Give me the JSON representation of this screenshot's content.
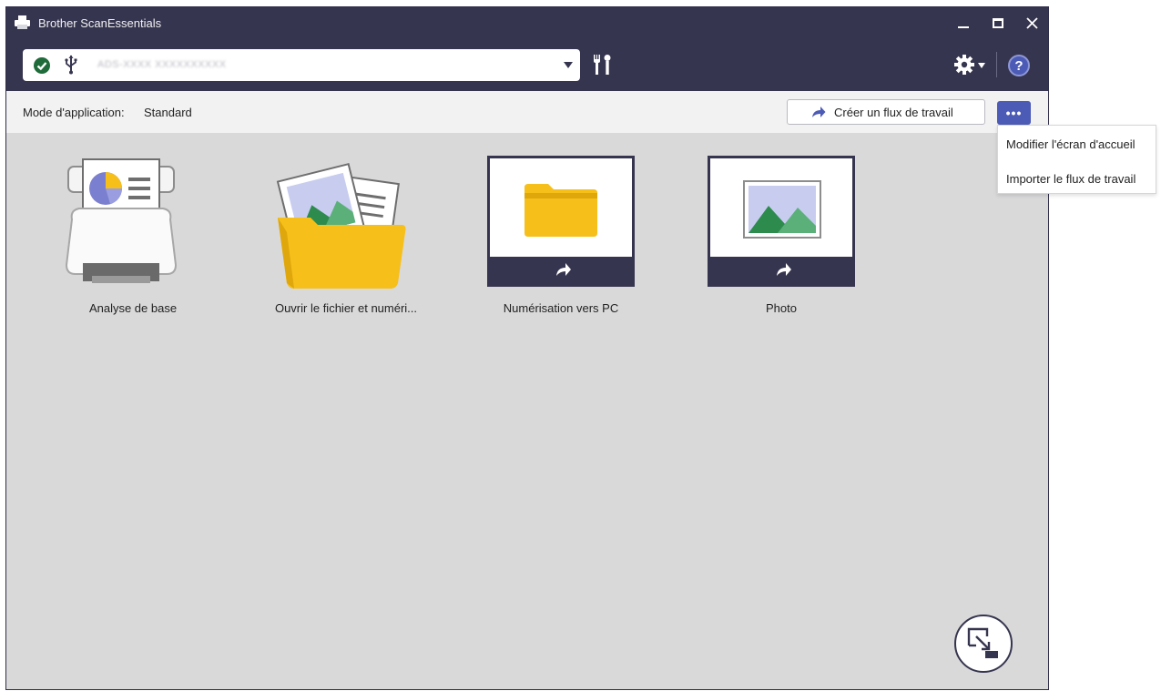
{
  "window": {
    "title": "Brother ScanEssentials"
  },
  "toolbar": {
    "device_name": "ADS-XXXX XXXXXXXXXX"
  },
  "mode_bar": {
    "mode_label": "Mode d'application:",
    "mode_value": "Standard",
    "create_workflow_label": "Créer un flux de travail",
    "more_label": "•••"
  },
  "menu": {
    "items": [
      "Modifier l'écran d'accueil",
      "Importer le flux de travail"
    ]
  },
  "tiles": [
    {
      "label": "Analyse de base"
    },
    {
      "label": "Ouvrir le fichier et numéri..."
    },
    {
      "label": "Numérisation vers PC"
    },
    {
      "label": "Photo"
    }
  ],
  "help": {
    "label": "?"
  },
  "colors": {
    "titlebar": "#36354f",
    "accent": "#4c5bb5",
    "folder": "#f6bf1a",
    "status_ok": "#1f6b3a"
  }
}
